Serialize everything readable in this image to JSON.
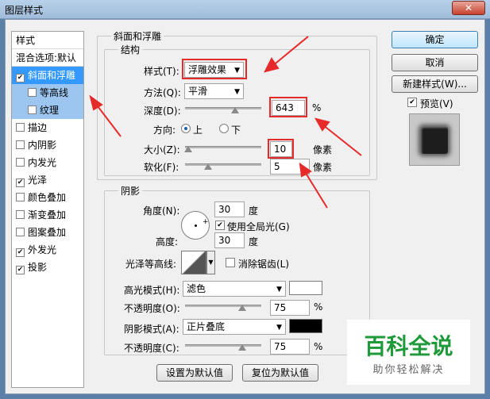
{
  "window": {
    "title": "图层样式",
    "close": "✕"
  },
  "style_list": {
    "header": "样式",
    "blend": "混合选项:默认",
    "items": [
      {
        "label": "斜面和浮雕",
        "checked": true,
        "selected": true
      },
      {
        "label": "等高线",
        "checked": false,
        "sub": true
      },
      {
        "label": "纹理",
        "checked": false,
        "sub": true
      },
      {
        "label": "描边",
        "checked": false
      },
      {
        "label": "内阴影",
        "checked": false
      },
      {
        "label": "内发光",
        "checked": false
      },
      {
        "label": "光泽",
        "checked": true
      },
      {
        "label": "颜色叠加",
        "checked": false
      },
      {
        "label": "渐变叠加",
        "checked": false
      },
      {
        "label": "图案叠加",
        "checked": false
      },
      {
        "label": "外发光",
        "checked": true
      },
      {
        "label": "投影",
        "checked": true
      }
    ]
  },
  "bevel": {
    "title": "斜面和浮雕",
    "structure": "结构",
    "style_label": "样式(T):",
    "style_value": "浮雕效果",
    "method_label": "方法(Q):",
    "method_value": "平滑",
    "depth_label": "深度(D):",
    "depth_value": "643",
    "depth_unit": "%",
    "depth_level": 0.66,
    "direction_label": "方向:",
    "dir_up": "上",
    "dir_down": "下",
    "size_label": "大小(Z):",
    "size_value": "10",
    "size_unit": "像素",
    "size_level": 0.04,
    "soften_label": "软化(F):",
    "soften_value": "5",
    "soften_unit": "像素",
    "soften_level": 0.3
  },
  "shading": {
    "title": "阴影",
    "angle_label": "角度(N):",
    "angle_value": "30",
    "angle_unit": "度",
    "global_light": "使用全局光(G)",
    "altitude_label": "高度:",
    "altitude_value": "30",
    "altitude_unit": "度",
    "gloss_label": "光泽等高线:",
    "antialias": "消除锯齿(L)",
    "highlight_label": "高光模式(H):",
    "highlight_value": "滤色",
    "highlight_color": "#ffffff",
    "op1_label": "不透明度(O):",
    "op1_value": "75",
    "op1_unit": "%",
    "op1_level": 0.75,
    "shadow_label": "阴影模式(A):",
    "shadow_value": "正片叠底",
    "shadow_color": "#000000",
    "op2_label": "不透明度(C):",
    "op2_value": "75",
    "op2_unit": "%",
    "op2_level": 0.75
  },
  "buttons": {
    "ok": "确定",
    "cancel": "取消",
    "new_style": "新建样式(W)...",
    "preview": "预览(V)",
    "make_default": "设置为默认值",
    "reset_default": "复位为默认值"
  },
  "watermark": {
    "line1": "百科全说",
    "line2": "助你轻松解决"
  },
  "colors": {
    "annotation": "#e62a2a",
    "selected": "#3399ff"
  }
}
